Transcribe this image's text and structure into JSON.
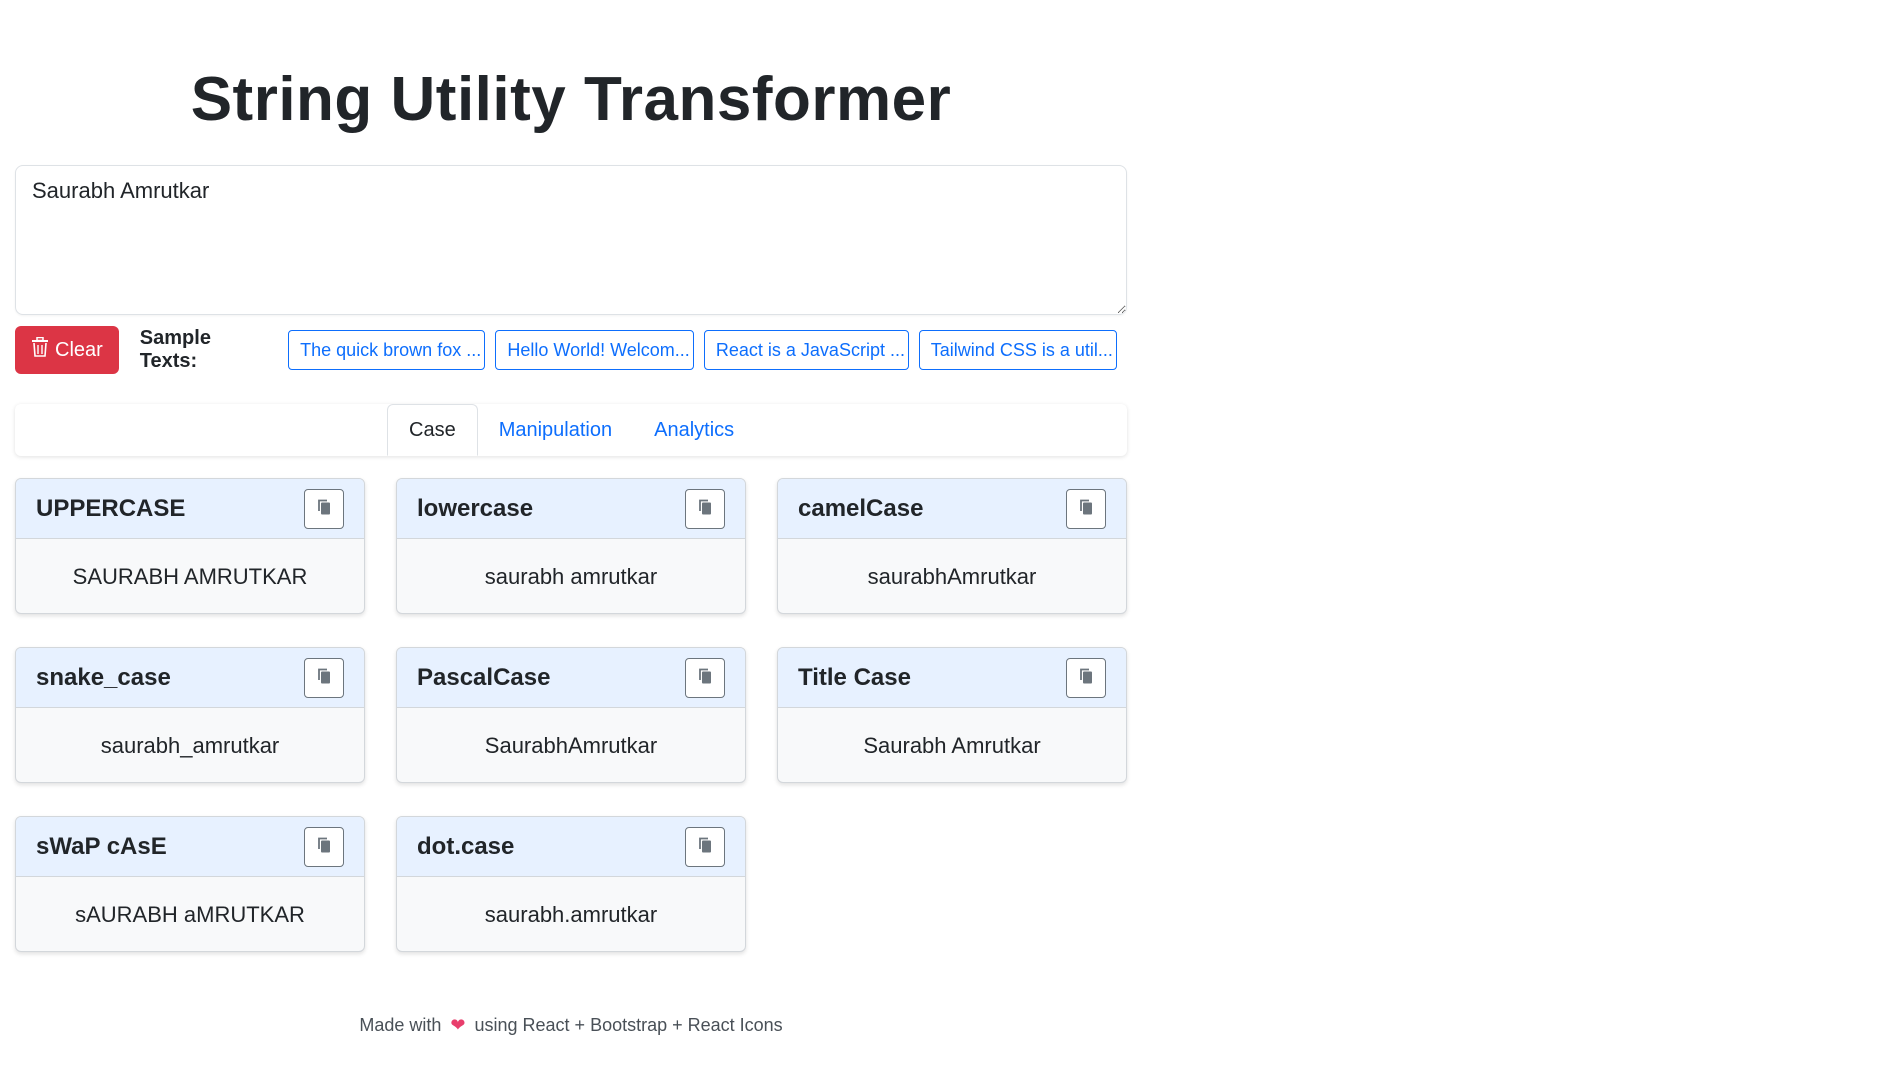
{
  "header": {
    "title": "String Utility Transformer"
  },
  "input": {
    "value": "Saurabh Amrutkar"
  },
  "toolbar": {
    "clear_label": "Clear",
    "sample_label": "Sample Texts:",
    "samples": [
      "The quick brown fox ...",
      "Hello World! Welcom...",
      "React is a JavaScript ...",
      "Tailwind CSS is a util..."
    ]
  },
  "tabs": [
    {
      "label": "Case",
      "active": true
    },
    {
      "label": "Manipulation",
      "active": false
    },
    {
      "label": "Analytics",
      "active": false
    }
  ],
  "cards": [
    {
      "title": "UPPERCASE",
      "value": "SAURABH AMRUTKAR"
    },
    {
      "title": "lowercase",
      "value": "saurabh amrutkar"
    },
    {
      "title": "camelCase",
      "value": "saurabhAmrutkar"
    },
    {
      "title": "snake_case",
      "value": "saurabh_amrutkar"
    },
    {
      "title": "PascalCase",
      "value": "SaurabhAmrutkar"
    },
    {
      "title": "Title Case",
      "value": "Saurabh Amrutkar"
    },
    {
      "title": "sWaP cAsE",
      "value": "sAURABH aMRUTKAR"
    },
    {
      "title": "dot.case",
      "value": "saurabh.amrutkar"
    }
  ],
  "footer": {
    "prefix": "Made with",
    "suffix": "using React + Bootstrap + React Icons"
  },
  "colors": {
    "danger": "#dc3545",
    "primary": "#0d6efd",
    "card_header": "#e7f1ff",
    "heart": "#e83e6c"
  },
  "icons": {
    "clear": "trash-icon",
    "copy": "copy-icon",
    "footer": "heart-icon"
  }
}
